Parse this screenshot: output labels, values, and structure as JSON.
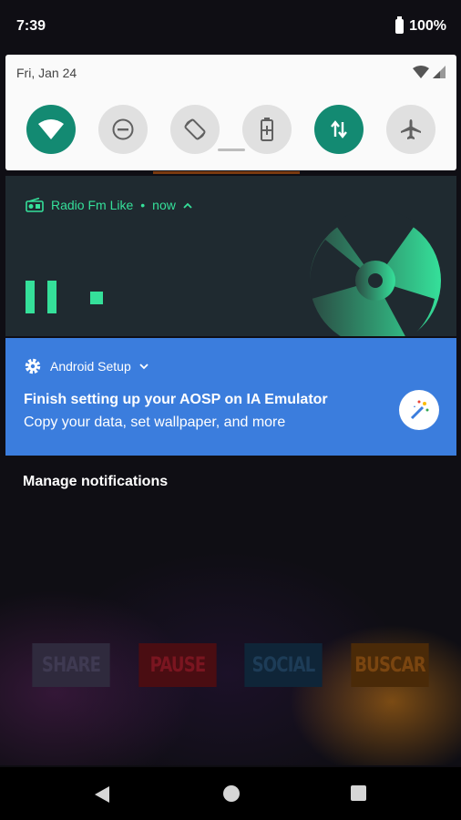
{
  "status_bar": {
    "time": "7:39",
    "battery": "100%"
  },
  "quick_settings": {
    "date": "Fri, Jan 24",
    "tiles": [
      {
        "name": "wifi",
        "state": "on"
      },
      {
        "name": "do-not-disturb",
        "state": "off"
      },
      {
        "name": "auto-rotate",
        "state": "off"
      },
      {
        "name": "battery-saver",
        "state": "off"
      },
      {
        "name": "mobile-data",
        "state": "on"
      },
      {
        "name": "airplane-mode",
        "state": "off"
      }
    ]
  },
  "media_notification": {
    "app_name": "Radio Fm Like",
    "time": "now",
    "accent_color": "#35e09a"
  },
  "setup_notification": {
    "app_name": "Android Setup",
    "title": "Finish setting up your AOSP on IA Emulator",
    "text": "Copy your data, set wallpaper, and more",
    "color": "#3b7ddd"
  },
  "manage_notifications": "Manage notifications",
  "background_app": {
    "buttons": [
      "SHARE",
      "PAUSE",
      "SOCIAL",
      "BUSCAR"
    ]
  }
}
